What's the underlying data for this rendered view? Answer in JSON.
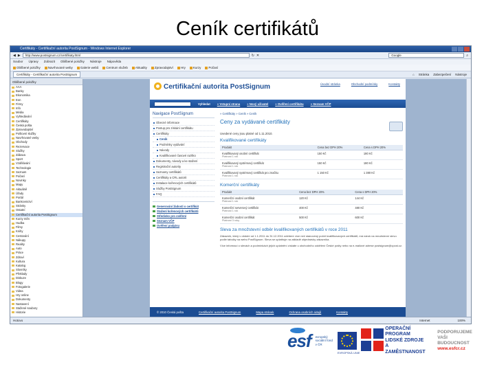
{
  "slide": {
    "title": "Ceník certifikátů"
  },
  "browser": {
    "window_title": "Certifikáty - Certifikační autorita PostSignum - Windows Internet Explorer",
    "address": "http://www.postsignum.cz/certifikaty.html",
    "search_placeholder": "Google",
    "menu": [
      "Soubor",
      "Úpravy",
      "Zobrazit",
      "Oblíbené položky",
      "Nástroje",
      "Nápověda"
    ],
    "favorites": [
      "Oblíbené položky",
      "Navrhované weby",
      "Galerie webů",
      "Centrum služeb",
      "Aktuality",
      "Zpravodajství",
      "Hry",
      "Kurzy",
      "Počasí"
    ],
    "tab": "Certifikáty - Certifikační autorita PostSignum",
    "commands": [
      "Stránka",
      "Zabezpečení",
      "Nástroje"
    ],
    "status_left": "Hotovo",
    "status_zone": "Internet",
    "status_zoom": "100%"
  },
  "sidebar": {
    "header": "Oblíbené položky",
    "items": [
      "AAA",
      "Banky",
      "Ekonomika",
      "Eon",
      "Firmy",
      "Info",
      "Média",
      "Vyhledávání",
      "Certifikáty",
      "Česká pošta",
      "Zpravodajství",
      "Poštovní služby",
      "Navrhované weby",
      "Obchody",
      "Rezervace",
      "Služby",
      "Zábava",
      "Sport",
      "Vzdělávání",
      "Technologie",
      "Seznam",
      "Počasí",
      "Novinky",
      "Mapy",
      "Aktuálně",
      "Úřady",
      "Portál",
      "Bankovnictví",
      "Stránky",
      "Ostatní",
      "Certifikační autorita PostSignum",
      "Kurzy měn",
      "Hudba",
      "Filmy",
      "Knihy",
      "Cestování",
      "Nákupy",
      "Reality",
      "Auto",
      "Práce",
      "Zdraví",
      "Kultura",
      "Katalog",
      "Slovníky",
      "Překlady",
      "Diskuze",
      "Blogy",
      "Fotogalerie",
      "Videa",
      "Hry online",
      "Dokumenty",
      "Nastavení",
      "Stažené soubory",
      "Historie"
    ],
    "selected_index": 30
  },
  "site": {
    "logo": "Certifikační autorita PostSignum",
    "toplinks": [
      "Úvodní stránka",
      "Obchodní podmínky",
      "Kontakty"
    ],
    "search_button": "Vyhledat",
    "nav_links": [
      "Vstupní strana",
      "Nový uživatel",
      "Ověření certifikátu",
      "Seznam VČP"
    ],
    "left_title": "Navigace PostSignum",
    "left_items": [
      {
        "label": "Obecné informace",
        "sub": false,
        "cur": false
      },
      {
        "label": "Postup pro získání certifikátu",
        "sub": false,
        "cur": false
      },
      {
        "label": "Certifikáty",
        "sub": false,
        "cur": false
      },
      {
        "label": "Ceník",
        "sub": true,
        "cur": true
      },
      {
        "label": "Podmínky vydávání",
        "sub": true,
        "cur": false
      },
      {
        "label": "Návody",
        "sub": true,
        "cur": false
      },
      {
        "label": "Kvalifikované časové razítko",
        "sub": true,
        "cur": false
      },
      {
        "label": "Dokumenty, návody a ke stažení",
        "sub": false,
        "cur": false
      },
      {
        "label": "Registrační autority",
        "sub": false,
        "cur": false
      },
      {
        "label": "Seznamy certifikátů",
        "sub": false,
        "cur": false
      },
      {
        "label": "Certifikáty a CRL autorit",
        "sub": false,
        "cur": false
      },
      {
        "label": "Instalace kořenových certifikátů",
        "sub": false,
        "cur": false
      },
      {
        "label": "Služby PostSignum",
        "sub": false,
        "cur": false
      },
      {
        "label": "FAQ",
        "sub": false,
        "cur": false
      }
    ],
    "left_links": [
      "Generování žádosti o certifikát",
      "Stažení kořenových certifikátů",
      "Středisko pro ověření",
      "Seznam VČP",
      "Ověření podpisu"
    ],
    "breadcrumb": "» Certifikáty » Ceník » Ceník",
    "heading": "Ceny za vydávané certifikáty",
    "meta": "Uvedené ceny jsou platné od 1.11.2010.",
    "section1": "Kvalifikované certifikáty",
    "table_headers": [
      "Produkt",
      "Cena bez DPH 20%",
      "Cena s DPH 20%"
    ],
    "rows1": [
      {
        "name": "Kvalifikovaný osobní certifikát",
        "note": "Platnost 1 rok",
        "net": "150 Kč",
        "gross": "180 Kč"
      },
      {
        "name": "Kvalifikovaný systémový certifikát",
        "note": "Platnost 1 rok",
        "net": "150 Kč",
        "gross": "180 Kč"
      },
      {
        "name": "Kvalifikovaný systémový certifikát pro značku",
        "note": "Platnost 1 rok",
        "net": "1 150 Kč",
        "gross": "1 380 Kč"
      }
    ],
    "section2": "Komerční certifikáty",
    "rows2": [
      {
        "name": "Komerční osobní certifikát",
        "note": "Platnost 1 rok",
        "net": "120 Kč",
        "gross": "144 Kč"
      },
      {
        "name": "Komerční serverový certifikát",
        "note": "Platnost 1 rok",
        "net": "400 Kč",
        "gross": "480 Kč"
      },
      {
        "name": "Komerční osobní certifikát",
        "note": "Platnost 3 roky",
        "net": "500 Kč",
        "gross": "600 Kč"
      }
    ],
    "section3": "Sleva za množstevní odběr kvalifikovaných certifikátů v roce 2011",
    "para1": "Zákazník, který v období od 1.1.2011 do 31.12.2011 odebere více než stanovený počet kvalifikovaných certifikátů, má nárok na množstevní slevu podle tabulky na webu PostSignum. Sleva se uplatňuje na základě objednávky zákazníka.",
    "para2": "Více informací o slevách a podmínkách jejich uplatnění získáte u obchodního oddělení České pošty nebo na e-mailové adrese postsignum@cpost.cz.",
    "footer": [
      "© 2010 Česká pošta",
      "Certifikační autorita PostSignum",
      "Mapa stránek",
      "Ochrana osobních údajů",
      "Kontakty"
    ]
  },
  "logos": {
    "esf": "esf",
    "esf_sub": "evropský sociální fond v ČR",
    "eu": "EVROPSKÁ UNIE",
    "op_text": [
      "OPERAČNÍ PROGRAM",
      "LIDSKÉ ZDROJE",
      "A ZAMĚSTNANOST"
    ],
    "support": [
      "PODPORUJEME",
      "VAŠI BUDOUCNOST"
    ],
    "web": "www.esfcr.cz"
  }
}
